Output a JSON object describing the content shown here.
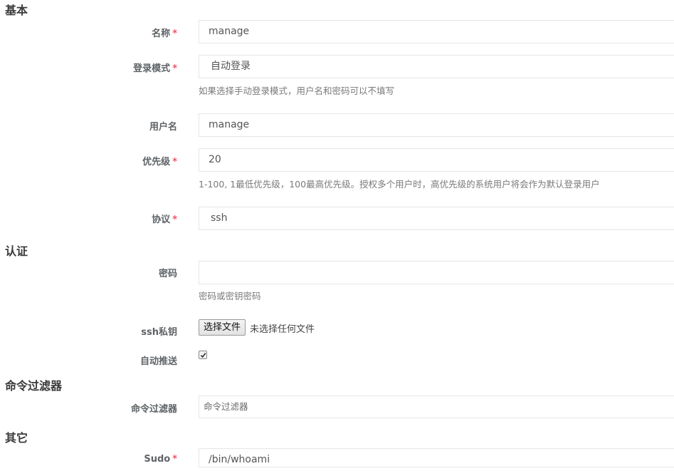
{
  "sections": {
    "basic": "基本",
    "auth": "认证",
    "command_filter": "命令过滤器",
    "other": "其它"
  },
  "fields": {
    "name": {
      "label": "名称",
      "required": "*",
      "value": "manage"
    },
    "login_mode": {
      "label": "登录模式",
      "required": "*",
      "value": "自动登录",
      "help": "如果选择手动登录模式，用户名和密码可以不填写"
    },
    "username": {
      "label": "用户名",
      "value": "manage"
    },
    "priority": {
      "label": "优先级",
      "required": "*",
      "value": "20",
      "help": "1-100, 1最低优先级，100最高优先级。授权多个用户时，高优先级的系统用户将会作为默认登录用户"
    },
    "protocol": {
      "label": "协议",
      "required": "*",
      "value": "ssh"
    },
    "password": {
      "label": "密码",
      "value": "",
      "help": "密码或密钥密码"
    },
    "ssh_key": {
      "label": "ssh私钥",
      "button": "选择文件",
      "status": "未选择任何文件"
    },
    "auto_push": {
      "label": "自动推送",
      "checked": true
    },
    "command_filters": {
      "label": "命令过滤器",
      "placeholder": "命令过滤器"
    },
    "sudo": {
      "label": "Sudo",
      "required": "*",
      "value": "/bin/whoami"
    }
  },
  "colors": {
    "required": "#ed5565",
    "border": "#e5e6e7"
  }
}
